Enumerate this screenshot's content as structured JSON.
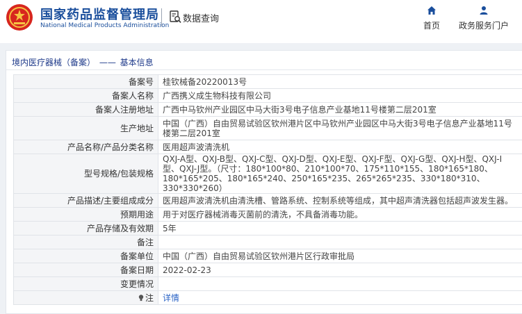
{
  "header": {
    "site_name": "国家药品监督管理局",
    "site_name_en": "National Medical Products Administration",
    "data_query_label": "数据查询",
    "nav": [
      {
        "label": "首页",
        "icon": "home-icon"
      },
      {
        "label": "政务服务门户",
        "icon": "user-icon"
      }
    ],
    "brand_color": "#1a4e9c"
  },
  "breadcrumb": {
    "section": "境内医疗器械（备案）",
    "separator": "——",
    "current": "基本信息"
  },
  "record": {
    "rows": [
      {
        "label": "备案号",
        "value": "桂钦械备20220013号"
      },
      {
        "label": "备案人名称",
        "value": "广西携义成生物科技有限公司"
      },
      {
        "label": "备案人注册地址",
        "value": "广西中马钦州产业园区中马大街3号电子信息产业基地11号楼第二层201室"
      },
      {
        "label": "生产地址",
        "value": "中国（广西）自由贸易试验区钦州港片区中马钦州产业园区中马大街3号电子信息产业基地11号楼第二层201室"
      },
      {
        "label": "产品名称/产品分类名称",
        "value": "医用超声波清洗机"
      },
      {
        "label": "型号规格/包装规格",
        "value": "QXJ-A型、QXJ-B型、QXJ-C型、QXJ-D型、QXJ-E型、QXJ-F型、QXJ-G型、QXJ-H型、QXJ-I型、QXJ-J型。（尺寸：180*100*80、210*100*70、175*110*155、180*165*180、180*165*205、180*165*240、250*165*235、265*265*235、330*180*310、330*330*260）"
      },
      {
        "label": "产品描述/主要组成成分",
        "value": "医用超声波清洗机由清洗槽、管路系统、控制系统等组成，其中超声清洗器包括超声波发生器。"
      },
      {
        "label": "预期用途",
        "value": "用于对医疗器械消毒灭菌前的清洗，不具备消毒功能。"
      },
      {
        "label": "产品存储及有效期",
        "value": "5年"
      },
      {
        "label": "备注",
        "value": ""
      },
      {
        "label": "备案单位",
        "value": "中国（广西）自由贸易试验区钦州港片区行政审批局"
      },
      {
        "label": "备案日期",
        "value": "2022-02-23"
      },
      {
        "label": "变更情况",
        "value": ""
      },
      {
        "label": "注",
        "value": "详情"
      }
    ]
  }
}
